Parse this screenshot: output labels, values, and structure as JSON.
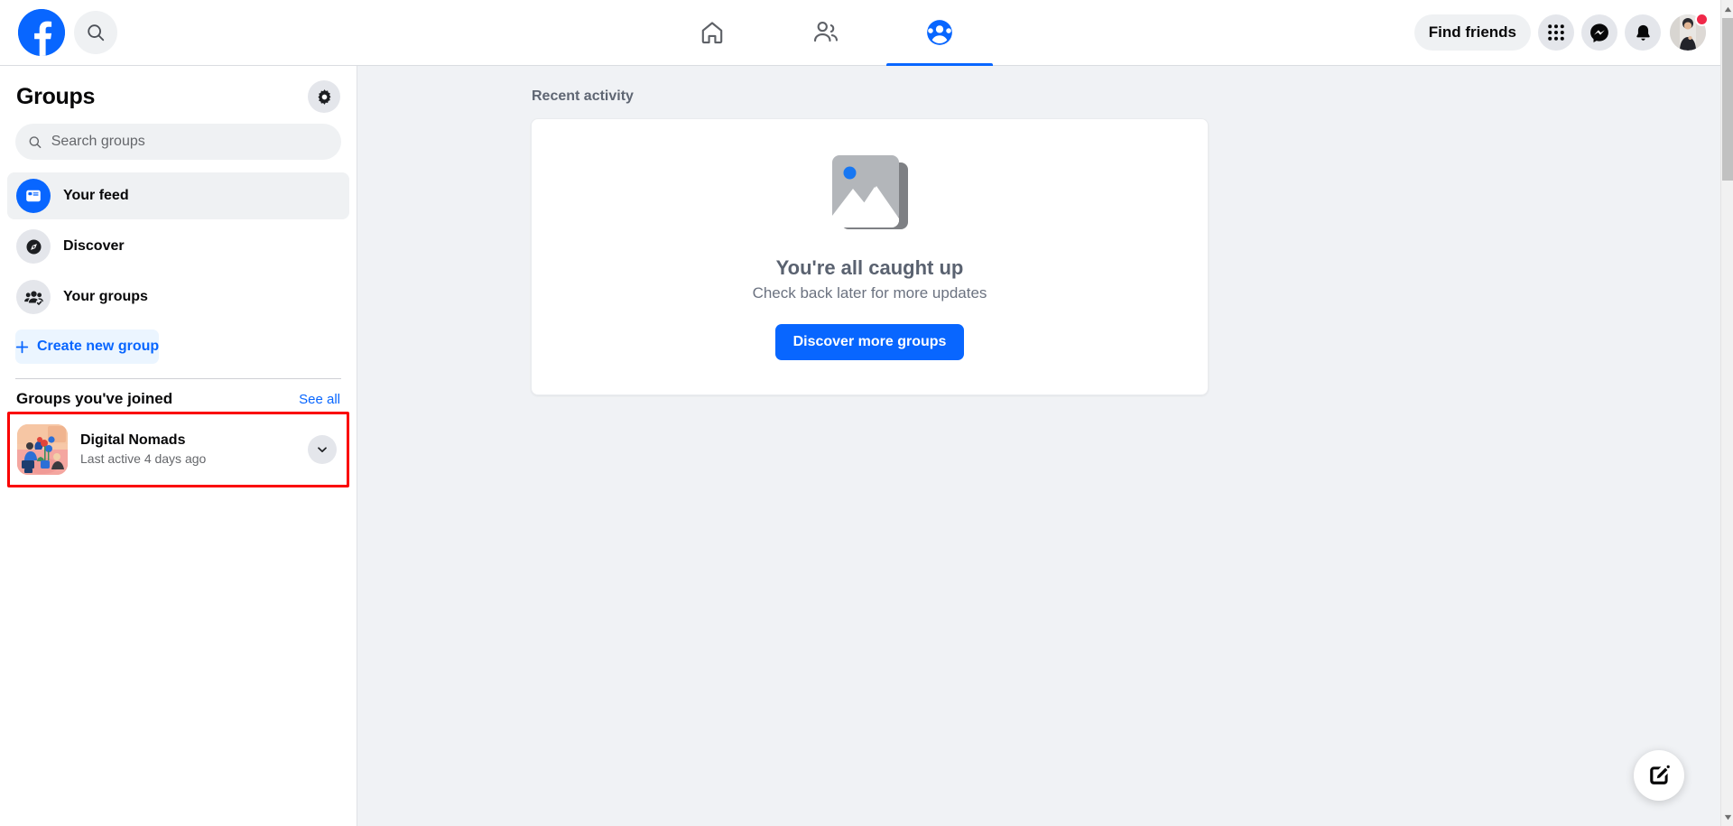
{
  "topbar": {
    "logo_icon": "facebook-logo",
    "search_icon": "search-icon",
    "tabs": [
      {
        "name": "home",
        "icon": "home-icon",
        "active": false
      },
      {
        "name": "friends",
        "icon": "friends-icon",
        "active": false
      },
      {
        "name": "groups",
        "icon": "groups-icon",
        "active": true
      }
    ],
    "find_friends_label": "Find friends",
    "menu_icon": "grid-menu-icon",
    "messenger_icon": "messenger-icon",
    "notifications_icon": "bell-icon",
    "avatar_icon": "profile-avatar",
    "avatar_badge": true
  },
  "sidebar": {
    "title": "Groups",
    "settings_icon": "gear-icon",
    "search": {
      "placeholder": "Search groups",
      "value": "",
      "icon": "search-icon"
    },
    "nav_items": [
      {
        "label": "Your feed",
        "icon": "feed-icon",
        "selected": true
      },
      {
        "label": "Discover",
        "icon": "compass-icon",
        "selected": false
      },
      {
        "label": "Your groups",
        "icon": "people-check-icon",
        "selected": false
      }
    ],
    "create_button": {
      "label": "Create new group",
      "icon": "plus-icon"
    },
    "joined_section": {
      "title": "Groups you've joined",
      "see_all_label": "See all"
    },
    "groups": [
      {
        "name": "Digital Nomads",
        "subtitle": "Last active 4 days ago",
        "thumbnail": "illustration-people-flowers",
        "chevron_icon": "chevron-down-icon",
        "highlighted": true
      }
    ]
  },
  "main": {
    "recent_activity_label": "Recent activity",
    "empty_state": {
      "illustration": "image-placeholder-icon",
      "title": "You're all caught up",
      "subtitle": "Check back later for more updates",
      "button_label": "Discover more groups"
    },
    "fab_icon": "compose-icon"
  },
  "scrollbar": {
    "up_arrow_icon": "scroll-up-arrow",
    "down_arrow_icon": "scroll-down-arrow"
  },
  "colors": {
    "brand_blue": "#0866ff",
    "page_bg": "#f0f2f5",
    "surface": "#ffffff",
    "highlight_red": "#fa0000",
    "muted_text": "#65676b"
  }
}
